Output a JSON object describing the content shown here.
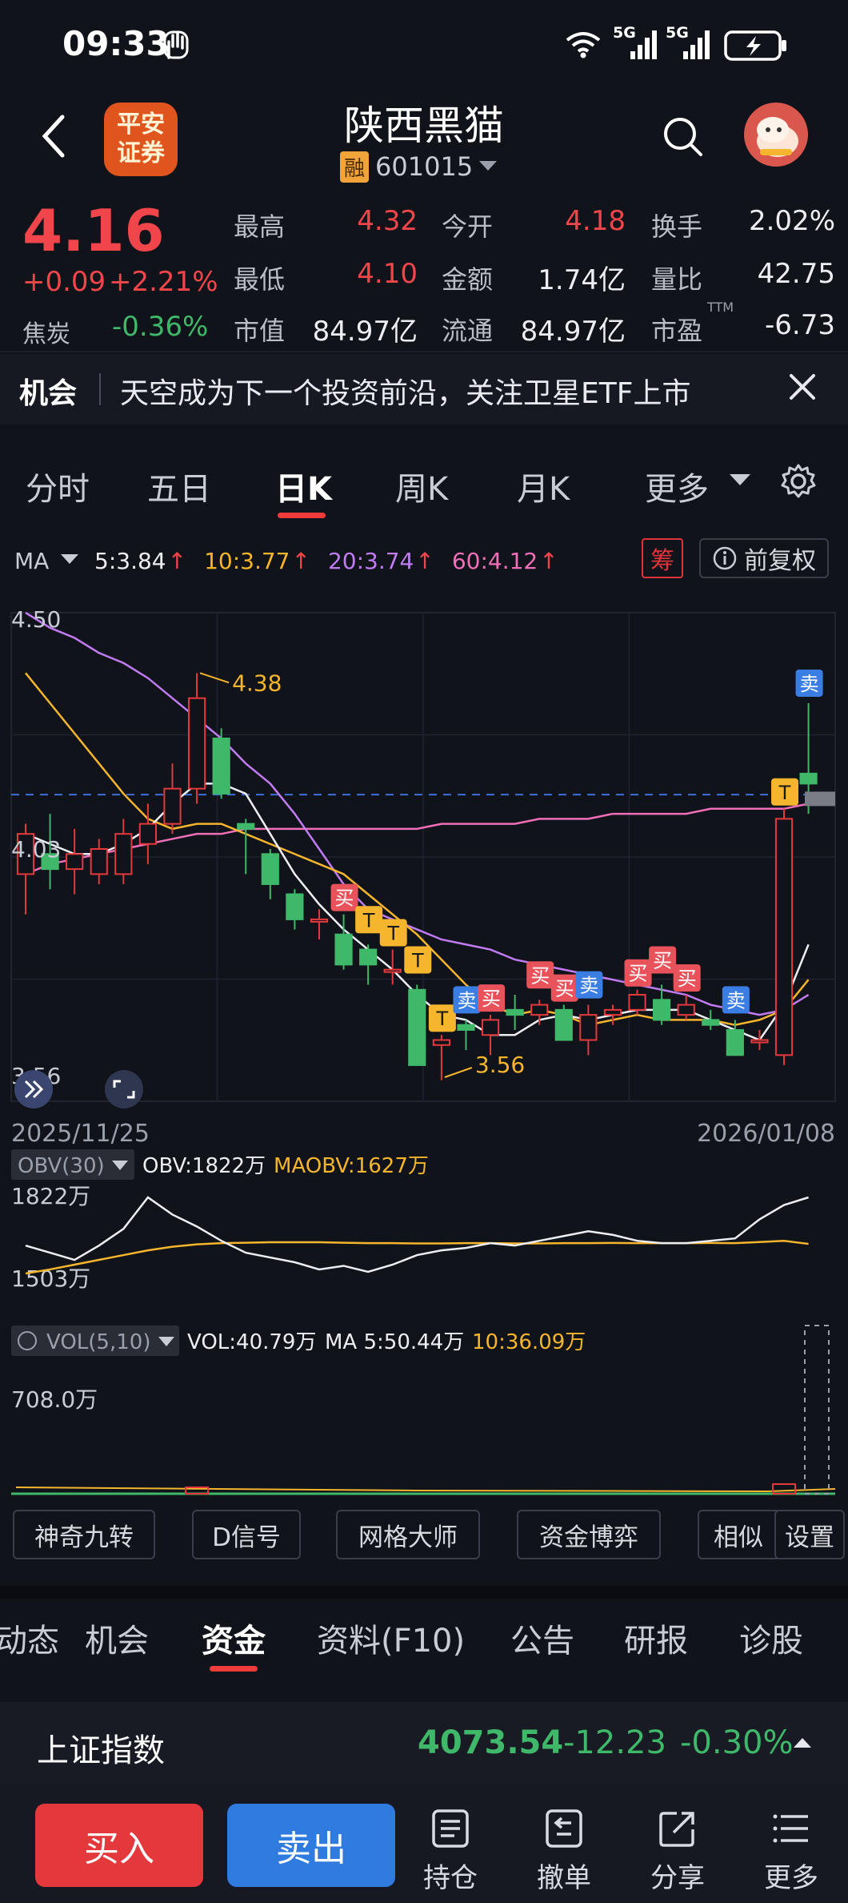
{
  "status": {
    "time": "09:33",
    "net1": "5G",
    "net2": "5G"
  },
  "header": {
    "broker_line1": "平安",
    "broker_line2": "证券",
    "name": "陕西黑猫",
    "badge": "融",
    "code": "601015"
  },
  "quote": {
    "price": "4.16",
    "change": "+0.09",
    "pct": "+2.21%",
    "related_name": "焦炭",
    "related_pct": "-0.36%",
    "rows": [
      [
        {
          "k": "最高",
          "v": "4.32",
          "c": "up"
        },
        {
          "k": "今开",
          "v": "4.18",
          "c": "up"
        },
        {
          "k": "换手",
          "v": "2.02%",
          "c": "wh"
        }
      ],
      [
        {
          "k": "最低",
          "v": "4.10",
          "c": "up"
        },
        {
          "k": "金额",
          "v": "1.74亿",
          "c": "wh"
        },
        {
          "k": "量比",
          "v": "42.75",
          "c": "wh"
        }
      ],
      [
        {
          "k": "市值",
          "v": "84.97亿",
          "c": "wh"
        },
        {
          "k": "流通",
          "v": "84.97亿",
          "c": "wh"
        },
        {
          "k": "市盈",
          "v": "-6.73",
          "c": "wh",
          "sup": "TTM"
        }
      ]
    ]
  },
  "notice": {
    "tag": "机会",
    "text": "天空成为下一个投资前沿，关注卫星ETF上市"
  },
  "chart_tabs": [
    "分时",
    "五日",
    "日K",
    "周K",
    "月K",
    "更多"
  ],
  "chart_tab_active": 2,
  "ma": {
    "label": "MA",
    "items": [
      {
        "text": "5:3.84",
        "color": "#eceef3"
      },
      {
        "text": "10:3.77",
        "color": "#f5b52c"
      },
      {
        "text": "20:3.74",
        "color": "#c17bf2"
      },
      {
        "text": "60:4.12",
        "color": "#f06fb8"
      }
    ],
    "chip": "筹",
    "fuquan": "前复权"
  },
  "chart_data": {
    "type": "candlestick",
    "y_top_label": "4.50",
    "y_mid_label": "4.03",
    "y_bottom_label": "3.56",
    "date_start": "2025/11/25",
    "date_end": "2026/01/08",
    "high_marker": "4.38",
    "low_marker": "3.56",
    "candles": [
      [
        3.98,
        4.06,
        4.08,
        3.9
      ],
      [
        4.02,
        3.99,
        4.1,
        3.95
      ],
      [
        3.99,
        4.02,
        4.07,
        3.94
      ],
      [
        3.98,
        4.03,
        4.05,
        3.96
      ],
      [
        3.98,
        4.06,
        4.09,
        3.96
      ],
      [
        4.04,
        4.08,
        4.12,
        4.0
      ],
      [
        4.08,
        4.15,
        4.2,
        4.06
      ],
      [
        4.15,
        4.33,
        4.38,
        4.12
      ],
      [
        4.25,
        4.14,
        4.27,
        4.13
      ],
      [
        4.08,
        4.07,
        4.09,
        3.98
      ],
      [
        4.02,
        3.96,
        4.03,
        3.93
      ],
      [
        3.94,
        3.89,
        3.95,
        3.87
      ],
      [
        3.89,
        3.89,
        3.91,
        3.85
      ],
      [
        3.86,
        3.8,
        3.9,
        3.79
      ],
      [
        3.83,
        3.8,
        3.84,
        3.76
      ],
      [
        3.79,
        3.79,
        3.83,
        3.76
      ],
      [
        3.75,
        3.6,
        3.76,
        3.6
      ],
      [
        3.64,
        3.65,
        3.66,
        3.57
      ],
      [
        3.68,
        3.67,
        3.69,
        3.63
      ],
      [
        3.66,
        3.69,
        3.7,
        3.62
      ],
      [
        3.71,
        3.7,
        3.74,
        3.67
      ],
      [
        3.7,
        3.72,
        3.73,
        3.68
      ],
      [
        3.71,
        3.65,
        3.72,
        3.65
      ],
      [
        3.65,
        3.7,
        3.72,
        3.62
      ],
      [
        3.7,
        3.71,
        3.72,
        3.68
      ],
      [
        3.71,
        3.74,
        3.75,
        3.7
      ],
      [
        3.73,
        3.69,
        3.76,
        3.68
      ],
      [
        3.7,
        3.72,
        3.74,
        3.69
      ],
      [
        3.69,
        3.68,
        3.71,
        3.67
      ],
      [
        3.67,
        3.62,
        3.69,
        3.62
      ],
      [
        3.65,
        3.65,
        3.67,
        3.63
      ],
      [
        3.62,
        4.09,
        4.11,
        3.6
      ],
      [
        4.18,
        4.16,
        4.32,
        4.1
      ]
    ],
    "ma5": [
      4.06,
      4.04,
      4.02,
      4.02,
      4.04,
      4.07,
      4.12,
      4.16,
      4.16,
      4.14,
      4.06,
      3.98,
      3.92,
      3.87,
      3.83,
      3.79,
      3.74,
      3.7,
      3.69,
      3.66,
      3.66,
      3.69,
      3.7,
      3.69,
      3.7,
      3.71,
      3.71,
      3.71,
      3.69,
      3.67,
      3.65,
      3.72,
      3.84
    ],
    "ma10": [
      4.38,
      4.32,
      4.26,
      4.2,
      4.14,
      4.09,
      4.07,
      4.08,
      4.08,
      4.06,
      4.04,
      4.02,
      4.0,
      3.98,
      3.94,
      3.9,
      3.86,
      3.81,
      3.76,
      3.72,
      3.7,
      3.71,
      3.7,
      3.68,
      3.69,
      3.7,
      3.69,
      3.69,
      3.69,
      3.68,
      3.69,
      3.71,
      3.77
    ],
    "ma20": [
      4.5,
      4.47,
      4.45,
      4.42,
      4.4,
      4.37,
      4.33,
      4.29,
      4.25,
      4.2,
      4.16,
      4.1,
      4.03,
      3.96,
      3.91,
      3.89,
      3.87,
      3.85,
      3.84,
      3.83,
      3.81,
      3.8,
      3.79,
      3.78,
      3.77,
      3.76,
      3.75,
      3.74,
      3.72,
      3.71,
      3.7,
      3.71,
      3.74
    ],
    "ma60": [
      3.98,
      4.0,
      4.01,
      4.02,
      4.03,
      4.04,
      4.05,
      4.06,
      4.06,
      4.07,
      4.07,
      4.07,
      4.07,
      4.07,
      4.07,
      4.07,
      4.07,
      4.08,
      4.08,
      4.08,
      4.08,
      4.09,
      4.09,
      4.09,
      4.1,
      4.1,
      4.1,
      4.1,
      4.11,
      4.11,
      4.11,
      4.11,
      4.12
    ],
    "signals": [
      {
        "i": 13,
        "t": "买",
        "c": "buy"
      },
      {
        "i": 14,
        "t": "T",
        "c": "t"
      },
      {
        "i": 15,
        "t": "T",
        "c": "t"
      },
      {
        "i": 16,
        "t": "T",
        "c": "t"
      },
      {
        "i": 17,
        "t": "T",
        "c": "t"
      },
      {
        "i": 18,
        "t": "卖",
        "c": "sell"
      },
      {
        "i": 19,
        "t": "买",
        "c": "buy"
      },
      {
        "i": 21,
        "t": "买",
        "c": "buy"
      },
      {
        "i": 22,
        "t": "买",
        "c": "buy"
      },
      {
        "i": 23,
        "t": "卖",
        "c": "sell"
      },
      {
        "i": 25,
        "t": "买",
        "c": "buy"
      },
      {
        "i": 26,
        "t": "买",
        "c": "buy"
      },
      {
        "i": 27,
        "t": "买",
        "c": "buy"
      },
      {
        "i": 29,
        "t": "卖",
        "c": "sell"
      },
      {
        "i": 31,
        "t": "T",
        "c": "t"
      },
      {
        "i": 32,
        "t": "卖",
        "c": "sell"
      }
    ],
    "obv_label": "OBV(30)",
    "obv_value": "OBV:1822万",
    "maobv_value": "MAOBV:1627万",
    "obv_top": "1822万",
    "obv_bottom": "1503万",
    "obv": [
      1620,
      1590,
      1560,
      1620,
      1690,
      1822,
      1750,
      1700,
      1640,
      1590,
      1570,
      1550,
      1520,
      1535,
      1510,
      1540,
      1580,
      1600,
      1610,
      1630,
      1620,
      1640,
      1660,
      1680,
      1665,
      1640,
      1630,
      1630,
      1640,
      1650,
      1730,
      1790,
      1822
    ],
    "maobv": [
      1503,
      1520,
      1540,
      1560,
      1580,
      1600,
      1615,
      1625,
      1630,
      1632,
      1634,
      1634,
      1634,
      1632,
      1630,
      1630,
      1629,
      1629,
      1630,
      1630,
      1629,
      1629,
      1630,
      1630,
      1631,
      1630,
      1630,
      1630,
      1631,
      1630,
      1635,
      1640,
      1627
    ],
    "vol_label": "VOL(5,10)",
    "vol_value": "VOL:40.79万",
    "vol_ma5": "MA 5:50.44万",
    "vol_ma10": "10:36.09万",
    "vol_top": "708.0万"
  },
  "tools": [
    "神奇九转",
    "D信号",
    "网格大师",
    "资金博弈",
    "相似",
    "设置"
  ],
  "tabs2": [
    "动态",
    "机会",
    "资金",
    "资料(F10)",
    "公告",
    "研报",
    "诊股"
  ],
  "tabs2_active": 2,
  "index": {
    "name": "上证指数",
    "value": "4073.54",
    "change": "-12.23",
    "pct": "-0.30%"
  },
  "bottom": {
    "buy": "买入",
    "sell": "卖出",
    "items": [
      "持仓",
      "撤单",
      "分享",
      "更多"
    ]
  }
}
